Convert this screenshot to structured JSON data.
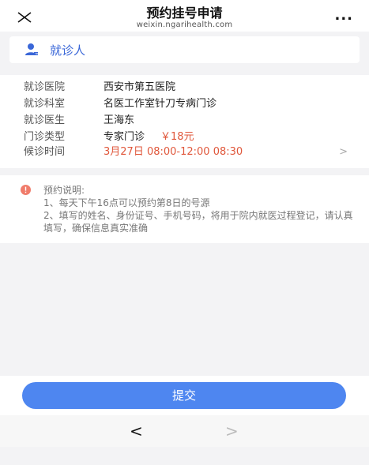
{
  "header": {
    "title": "预约挂号申请",
    "subtitle": "weixin.ngarihealth.com",
    "more_label": "..."
  },
  "patient": {
    "label": "就诊人"
  },
  "info": {
    "hospital": {
      "key": "就诊医院",
      "value": "西安市第五医院"
    },
    "department": {
      "key": "就诊科室",
      "value": "名医工作室针刀专病门诊"
    },
    "doctor": {
      "key": "就诊医生",
      "value": "王海东"
    },
    "clinic_type": {
      "key": "门诊类型",
      "value": "专家门诊",
      "fee": "￥18元"
    },
    "time": {
      "key": "候诊时间",
      "value": "3月27日 08:00-12:00 08:30",
      "arrow": ">"
    }
  },
  "notice": {
    "title": "预约说明:",
    "item1": "1、每天下午16点可以预约第8日的号源",
    "item2": "2、填写的姓名、身份证号、手机号码，将用于院内就医过程登记，请认真填写，确保信息真实准确"
  },
  "submit": {
    "label": "提交"
  },
  "nav": {
    "back": "<",
    "forward": ">"
  },
  "colors": {
    "accent": "#4e86f0",
    "patient_text": "#3a67d8",
    "highlight": "#e0573b",
    "notice_icon": "#f07c6b"
  }
}
